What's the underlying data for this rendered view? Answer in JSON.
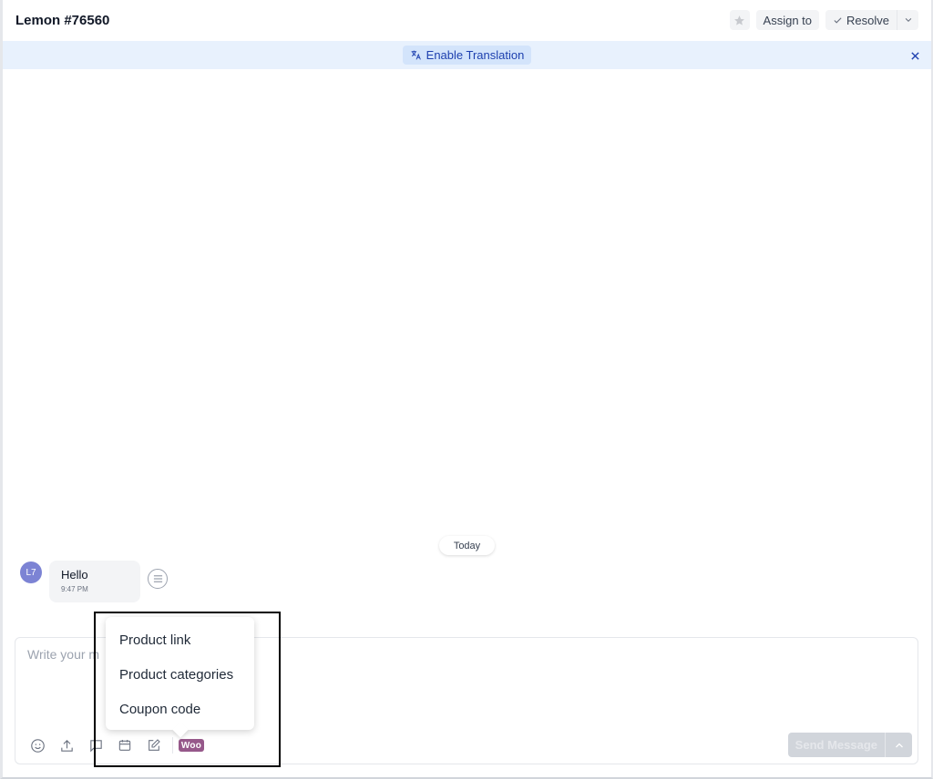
{
  "header": {
    "title": "Lemon #76560",
    "star_icon": "star-icon",
    "assign_label": "Assign to",
    "resolve_label": "Resolve"
  },
  "banner": {
    "translate_label": "Enable Translation",
    "translate_icon": "translate-icon",
    "close_icon": "close-icon",
    "background": "#e8f1fd"
  },
  "conversation": {
    "date_label": "Today",
    "messages": [
      {
        "avatar_initials": "L7",
        "avatar_color": "#7c83d4",
        "text": "Hello",
        "time": "9:47 PM"
      }
    ]
  },
  "composer": {
    "placeholder": "Write your m",
    "toolbar": [
      {
        "icon": "emoji-icon"
      },
      {
        "icon": "upload-icon"
      },
      {
        "icon": "chat-icon"
      },
      {
        "icon": "calendar-icon"
      },
      {
        "icon": "edit-icon"
      },
      {
        "icon": "woocommerce-icon",
        "label": "Woo"
      }
    ],
    "send_label": "Send Message"
  },
  "popup_menu": {
    "items": [
      "Product link",
      "Product categories",
      "Coupon code"
    ]
  },
  "colors": {
    "woo_brand": "#96588a",
    "accent_blue": "#1e40af",
    "avatar": "#7c83d4"
  }
}
